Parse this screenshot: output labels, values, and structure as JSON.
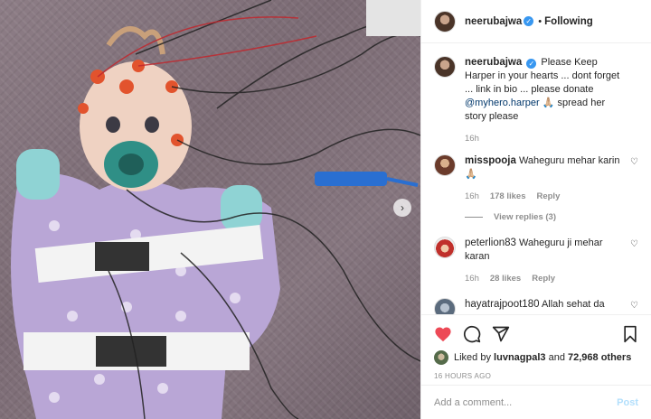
{
  "post": {
    "author": "neerubajwa",
    "follow_state": "Following",
    "separator": "•"
  },
  "caption": {
    "author": "neerubajwa",
    "text_before": "Please Keep Harper in your hearts ... dont forget ... link in bio ... please donate",
    "mention": "@myhero.harper",
    "text_after": "🙏🏼 spread her story please",
    "time": "16h"
  },
  "comments": [
    {
      "user": "misspooja",
      "text": "Waheguru mehar karin 🙏🏼",
      "time": "16h",
      "likes": "178 likes",
      "reply": "Reply"
    },
    {
      "user": "peterlion83",
      "text": "Waheguru ji mehar karan",
      "time": "16h",
      "likes": "28 likes",
      "reply": "Reply"
    },
    {
      "user": "hayatrajpoot180",
      "text": "Allah sehat da",
      "time": "",
      "likes": "",
      "reply": ""
    }
  ],
  "view_replies": "View replies (3)",
  "likes": {
    "prefix": "Liked by",
    "user": "luvnagpal3",
    "and": "and",
    "others": "72,968 others"
  },
  "posted_ago": "16 HOURS AGO",
  "add_comment": {
    "placeholder": "Add a comment...",
    "post_label": "Post"
  },
  "icons": {
    "like": "heart-icon",
    "comment": "comment-icon",
    "share": "share-icon",
    "save": "bookmark-icon",
    "next": "chevron-right-icon",
    "verified": "verified-badge-icon"
  },
  "colors": {
    "like_red": "#ed4956",
    "verified_blue": "#3897f0",
    "post_disabled": "#b2dffc",
    "mention": "#00376b"
  }
}
